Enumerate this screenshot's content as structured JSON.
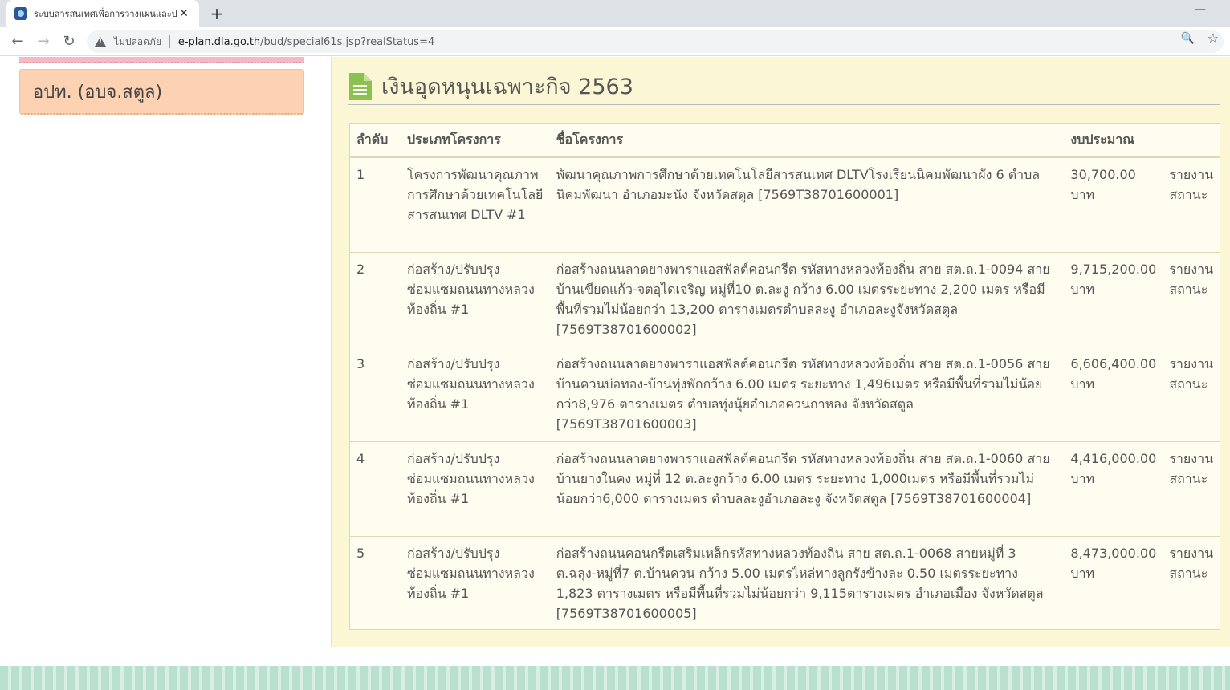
{
  "browser": {
    "tab_title": "ระบบสารสนเทศเพื่อการวางแผนและประ",
    "close_glyph": "✕",
    "newtab_glyph": "+",
    "minimize_glyph": "—",
    "back_glyph": "←",
    "forward_glyph": "→",
    "reload_glyph": "↻",
    "insecure_label": "ไม่ปลอดภัย",
    "url_host": "e-plan.dla.go.th",
    "url_path": "/bud/special61s.jsp?realStatus=4",
    "zoom_glyph": "🔍",
    "star_glyph": "☆"
  },
  "sidebar": {
    "card_label": "อปท. (อบจ.สตูล)"
  },
  "main": {
    "heading": "เงินอุดหนุนเฉพาะกิจ 2563",
    "columns": [
      "ลำดับ",
      "ประเภทโครงการ",
      "ชื่อโครงการ",
      "งบประมาณ",
      ""
    ],
    "rows": [
      {
        "no": "1",
        "type": "โครงการพัฒนาคุณภาพการศึกษาด้วยเทคโนโลยีสารสนเทศ DLTV #1",
        "name": "พัฒนาคุณภาพการศึกษาด้วยเทคโนโลยีสารสนเทศ DLTVโรงเรียนนิคมพัฒนาผัง 6 ตำบลนิคมพัฒนา อำเภอมะนัง จังหวัดสตูล [7569T38701600001]",
        "budget": "30,700.00 บาท",
        "status": "รายงานสถานะ"
      },
      {
        "no": "2",
        "type": "ก่อสร้าง/ปรับปรุงซ่อมแซมถนนทางหลวงท้องถิ่น #1",
        "name": "ก่อสร้างถนนลาดยางพาราแอสฟัลต์คอนกรีต รหัสทางหลวงท้องถิ่น สาย สต.ถ.1-0094 สายบ้านเขียดแก้ว-จตอุไดเจริญ หมู่ที่10 ต.ละงู กว้าง 6.00 เมตรระยะทาง 2,200 เมตร หรือมีพื้นที่รวมไม่น้อยกว่า 13,200 ตารางเมตรตำบลละงู อำเภอละงูจังหวัดสตูล [7569T38701600002]",
        "budget": "9,715,200.00 บาท",
        "status": "รายงานสถานะ"
      },
      {
        "no": "3",
        "type": "ก่อสร้าง/ปรับปรุงซ่อมแซมถนนทางหลวงท้องถิ่น #1",
        "name": "ก่อสร้างถนนลาดยางพาราแอสฟัลต์คอนกรีต รหัสทางหลวงท้องถิ่น สาย สต.ถ.1-0056 สายบ้านควนบ่อทอง-บ้านทุ่งพักกว้าง 6.00 เมตร ระยะทาง 1,496เมตร หรือมีพื้นที่รวมไม่น้อยกว่า8,976 ตารางเมตร ตำบลทุ่งนุ้ยอำเภอควนกาหลง จังหวัดสตูล [7569T38701600003]",
        "budget": "6,606,400.00 บาท",
        "status": "รายงานสถานะ"
      },
      {
        "no": "4",
        "type": "ก่อสร้าง/ปรับปรุงซ่อมแซมถนนทางหลวงท้องถิ่น #1",
        "name": "ก่อสร้างถนนลาดยางพาราแอสฟัลต์คอนกรีต รหัสทางหลวงท้องถิ่น สาย สต.ถ.1-0060 สายบ้านยางในคง หมู่ที่ 12 ต.ละงูกว้าง 6.00 เมตร ระยะทาง 1,000เมตร หรือมีพื้นที่รวมไม่น้อยกว่า6,000 ตารางเมตร ตำบลละงูอำเภอละงู จังหวัดสตูล [7569T38701600004]",
        "budget": "4,416,000.00 บาท",
        "status": "รายงานสถานะ"
      },
      {
        "no": "5",
        "type": "ก่อสร้าง/ปรับปรุงซ่อมแซมถนนทางหลวงท้องถิ่น #1",
        "name": "ก่อสร้างถนนคอนกรีตเสริมเหล็กรหัสทางหลวงท้องถิ่น สาย สต.ถ.1-0068 สายหมู่ที่ 3 ต.ฉลุง-หมู่ที่7 ต.บ้านควน กว้าง 5.00 เมตรไหล่ทางลูกรังข้างละ 0.50 เมตรระยะทาง 1,823 ตารางเมตร หรือมีพื้นที่รวมไม่น้อยกว่า 9,115ตารางเมตร อำเภอเมือง จังหวัดสตูล [7569T38701600005]",
        "budget": "8,473,000.00 บาท",
        "status": "รายงานสถานะ"
      }
    ]
  },
  "colors": {
    "panel_bg": "#fbf6d4",
    "card_bg": "#fdd2b2",
    "doc_icon": "#8cc152"
  },
  "icons": {
    "heading_icon": "document-icon",
    "favicon": "site-favicon"
  }
}
